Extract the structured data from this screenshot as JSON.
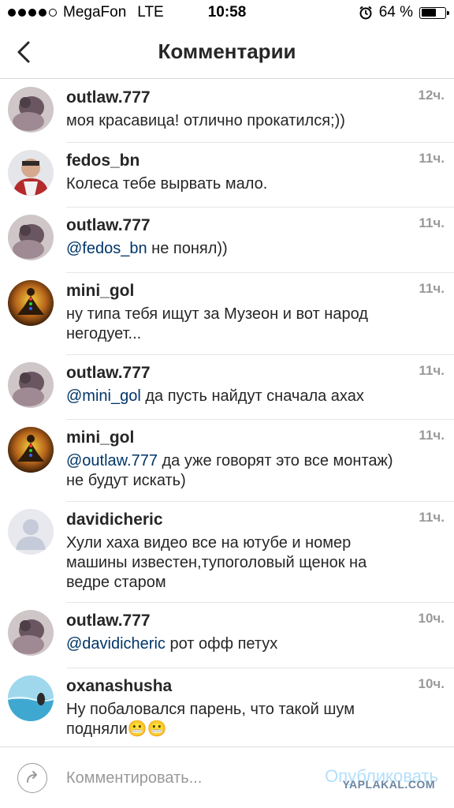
{
  "status_bar": {
    "carrier": "MegaFon",
    "network": "LTE",
    "time": "10:58",
    "battery_text": "64 %",
    "battery_level": 0.64
  },
  "nav": {
    "title": "Комментарии"
  },
  "comments": [
    {
      "user": "outlaw.777",
      "mention": "",
      "text": "моя красавица! отлично прокатился;))",
      "time": "12ч.",
      "avatar": "avatar-outlaw"
    },
    {
      "user": "fedos_bn",
      "mention": "",
      "text": "Колеса тебе вырвать мало.",
      "time": "11ч.",
      "avatar": "avatar-fedos"
    },
    {
      "user": "outlaw.777",
      "mention": "@fedos_bn",
      "text": " не понял))",
      "time": "11ч.",
      "avatar": "avatar-outlaw"
    },
    {
      "user": "mini_gol",
      "mention": "",
      "text": "ну типа тебя ищут за Музеон и вот народ негодует...",
      "time": "11ч.",
      "avatar": "avatar-minigol"
    },
    {
      "user": "outlaw.777",
      "mention": "@mini_gol",
      "text": " да пусть найдут сначала ахах",
      "time": "11ч.",
      "avatar": "avatar-outlaw"
    },
    {
      "user": "mini_gol",
      "mention": "@outlaw.777",
      "text": " да уже говорят это все монтаж) не будут искать)",
      "time": "11ч.",
      "avatar": "avatar-minigol"
    },
    {
      "user": "davidicheric",
      "mention": "",
      "text": "Хули хаха видео все на ютубе и номер машины известен,тупоголовый щенок на ведре старом",
      "time": "11ч.",
      "avatar": "avatar-default"
    },
    {
      "user": "outlaw.777",
      "mention": "@davidicheric",
      "text": " рот офф петух",
      "time": "10ч.",
      "avatar": "avatar-outlaw"
    },
    {
      "user": "oxanashusha",
      "mention": "",
      "text": "Ну побаловался парень, что такой шум подняли😬😬",
      "time": "10ч.",
      "avatar": "avatar-oxana"
    }
  ],
  "composer": {
    "placeholder": "Комментировать...",
    "publish_label": "Опубликовать",
    "watermark": "YAPLAKAL.COM"
  },
  "colors": {
    "mention": "#003569",
    "time": "#999999",
    "publish_disabled": "#b2dffc"
  }
}
